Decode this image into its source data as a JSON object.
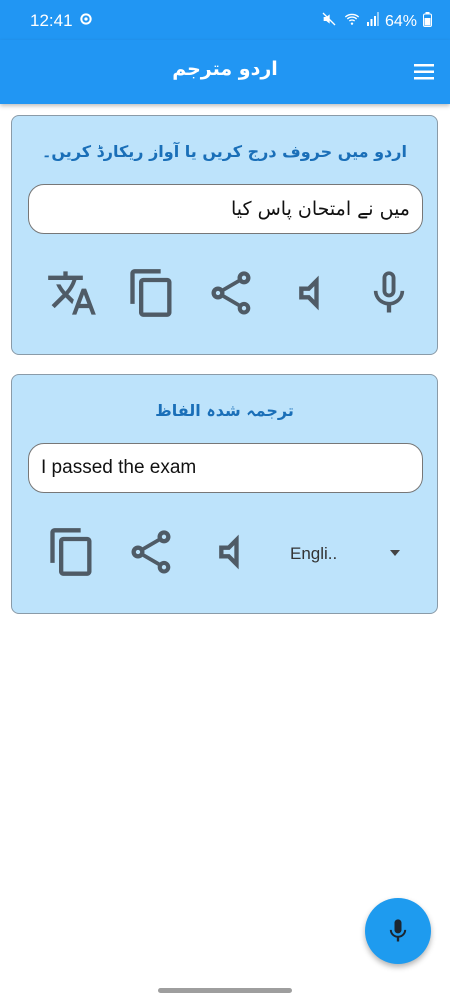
{
  "status_bar": {
    "time": "12:41",
    "battery": "64%",
    "icons": [
      "settings-gear-icon",
      "mute-icon",
      "wifi-icon",
      "signal-icon",
      "battery-icon"
    ]
  },
  "app_bar": {
    "title": "اردو مترجم",
    "menu_icon": "menu-icon"
  },
  "input_card": {
    "prompt": "اردو میں حروف درج کریں یا آواز ریکارڈ کریں۔",
    "text_value": "میں نے امتحان پاس کیا",
    "actions": [
      "translate-icon",
      "copy-icon",
      "share-icon",
      "volume-icon",
      "mic-icon"
    ]
  },
  "output_card": {
    "title": "ترجمہ شدہ الفاظ",
    "text_value": "I passed the exam",
    "actions": [
      "copy-icon",
      "share-icon",
      "volume-icon"
    ],
    "language_selected": "Engli.."
  },
  "fab": {
    "icon": "mic-icon"
  },
  "colors": {
    "primary": "#2196f3",
    "card_bg": "#bde3fb",
    "title_blue": "#1a6fb8",
    "icon_gray": "#4f5b66",
    "fab": "#1e9bef"
  }
}
